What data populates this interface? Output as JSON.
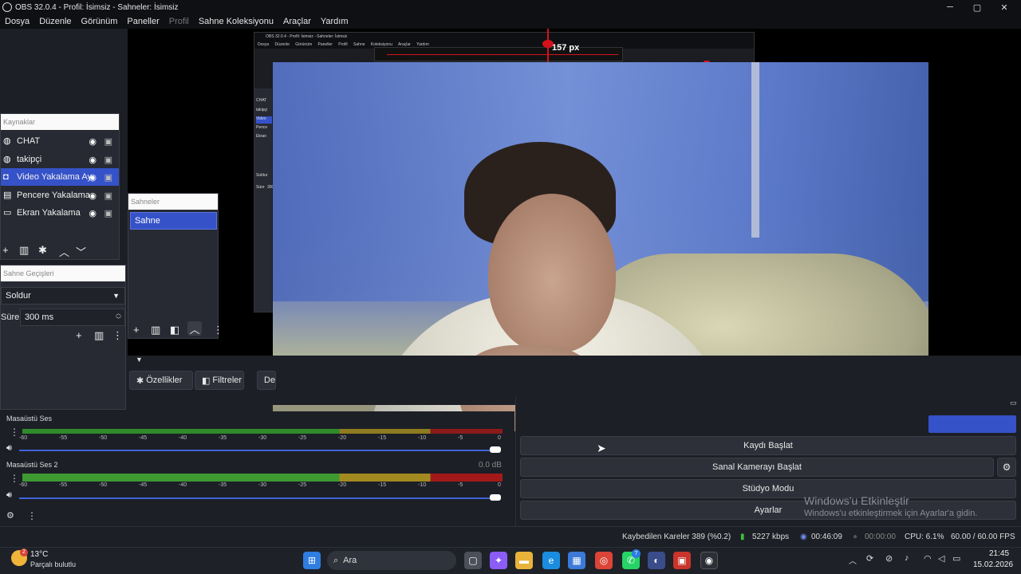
{
  "window": {
    "title": "OBS 32.0.4 - Profil: İsimsiz - Sahneler: İsimsiz",
    "minimize_icon": "─",
    "maximize_icon": "▢",
    "close_icon": "✕"
  },
  "menu": [
    "Dosya",
    "Düzenle",
    "Görünüm",
    "Paneller",
    "Profil",
    "Sahne Koleksiyonu",
    "Araçlar",
    "Yardım"
  ],
  "nested_preview": {
    "title": "OBS 32.0.4 - Profil: İsimsiz - Sahneler: İsimsiz",
    "menu": "Dosya Düzenle Görünüm Paneller Profil Sahne Koleksiyonu Araçlar Yardım",
    "sources": [
      "CHAT",
      "takipçi",
      "Video",
      "Pence",
      "Ekran"
    ],
    "transition": "Soldur",
    "duration_label": "Süre",
    "duration_value": "300"
  },
  "preview_measure": "157 px",
  "sources": {
    "title": "Kaynaklar",
    "items": [
      {
        "icon": "globe-icon",
        "label": "CHAT",
        "selected": false
      },
      {
        "icon": "globe-icon",
        "label": "takipçi",
        "selected": false
      },
      {
        "icon": "camera-icon",
        "label": "Video Yakalama Ay",
        "selected": true
      },
      {
        "icon": "window-icon",
        "label": "Pencere Yakalama",
        "selected": false
      },
      {
        "icon": "monitor-icon",
        "label": "Ekran Yakalama",
        "selected": false
      }
    ]
  },
  "scenes": {
    "title": "Sahneler",
    "items": [
      "Sahne"
    ]
  },
  "transitions": {
    "title": "Sahne Geçişleri",
    "selected": "Soldur",
    "duration_label": "Süre",
    "duration_value": "300 ms"
  },
  "source_toolbar": {
    "properties": "Özellikler",
    "filters": "Filtreler",
    "truncated": "De"
  },
  "mixer": {
    "scale": [
      "-60",
      "-55",
      "-50",
      "-45",
      "-40",
      "-35",
      "-30",
      "-25",
      "-20",
      "-15",
      "-10",
      "-5",
      "0"
    ],
    "tracks": [
      {
        "name": "Masaüstü Ses",
        "db": "",
        "volume": 1.0
      },
      {
        "name": "Masaüstü Ses 2",
        "db": "0.0 dB",
        "volume": 1.0
      }
    ]
  },
  "controls": {
    "start_recording": "Kaydı Başlat",
    "start_virtualcam": "Sanal Kamerayı Başlat",
    "studio_mode": "Stüdyo Modu",
    "settings": "Ayarlar"
  },
  "activation": {
    "title": "Windows'u Etkinleştir",
    "subtitle": "Windows'u etkinleştirmek için Ayarlar'a gidin."
  },
  "status": {
    "dropped_frames": "Kaybedilen Kareler 389 (%0.2)",
    "bitrate": "5227 kbps",
    "stream_time": "00:46:09",
    "rec_time": "00:00:00",
    "cpu": "CPU: 6.1%",
    "fps": "60.00 / 60.00 FPS"
  },
  "taskbar": {
    "weather_temp": "13°C",
    "weather_desc": "Parçalı bulutlu",
    "weather_badge": "2",
    "search": "Ara",
    "whatsapp_badge": "7",
    "time": "21:45",
    "date": "15.02.2026"
  },
  "colors": {
    "selected_row": "#3552c9",
    "slider_blue": "#3e64d8",
    "meter_green": "#2f8a2a",
    "meter_yellow": "#8d7b1f",
    "meter_red": "#8c1a1a"
  }
}
